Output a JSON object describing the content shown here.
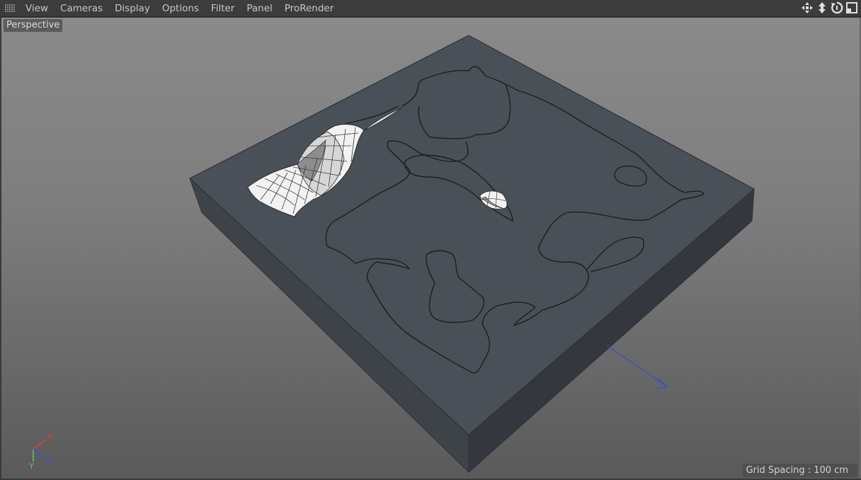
{
  "menubar": {
    "items": [
      {
        "id": "view",
        "label": "View"
      },
      {
        "id": "cameras",
        "label": "Cameras"
      },
      {
        "id": "display",
        "label": "Display"
      },
      {
        "id": "options",
        "label": "Options"
      },
      {
        "id": "filter",
        "label": "Filter"
      },
      {
        "id": "panel",
        "label": "Panel"
      },
      {
        "id": "prorender",
        "label": "ProRender"
      }
    ],
    "nav_icons": [
      "move-view-icon",
      "zoom-view-icon",
      "rotate-view-icon",
      "maximize-view-icon"
    ]
  },
  "viewport": {
    "camera_label": "Perspective",
    "grid_spacing_label": "Grid Spacing : 100 cm",
    "axis": {
      "x": "X",
      "y": "Y",
      "z": "Z"
    }
  },
  "colors": {
    "menubar_bg": "#3c3c3c",
    "menu_text": "#c8c8c8",
    "block_top": "#4a5058",
    "block_front": "#3d4249",
    "block_side": "#363a40",
    "mesh_face": "#f0f0f0",
    "axis_x": "#d8403a",
    "axis_y": "#5ec25a",
    "axis_z": "#3c4cd6"
  }
}
